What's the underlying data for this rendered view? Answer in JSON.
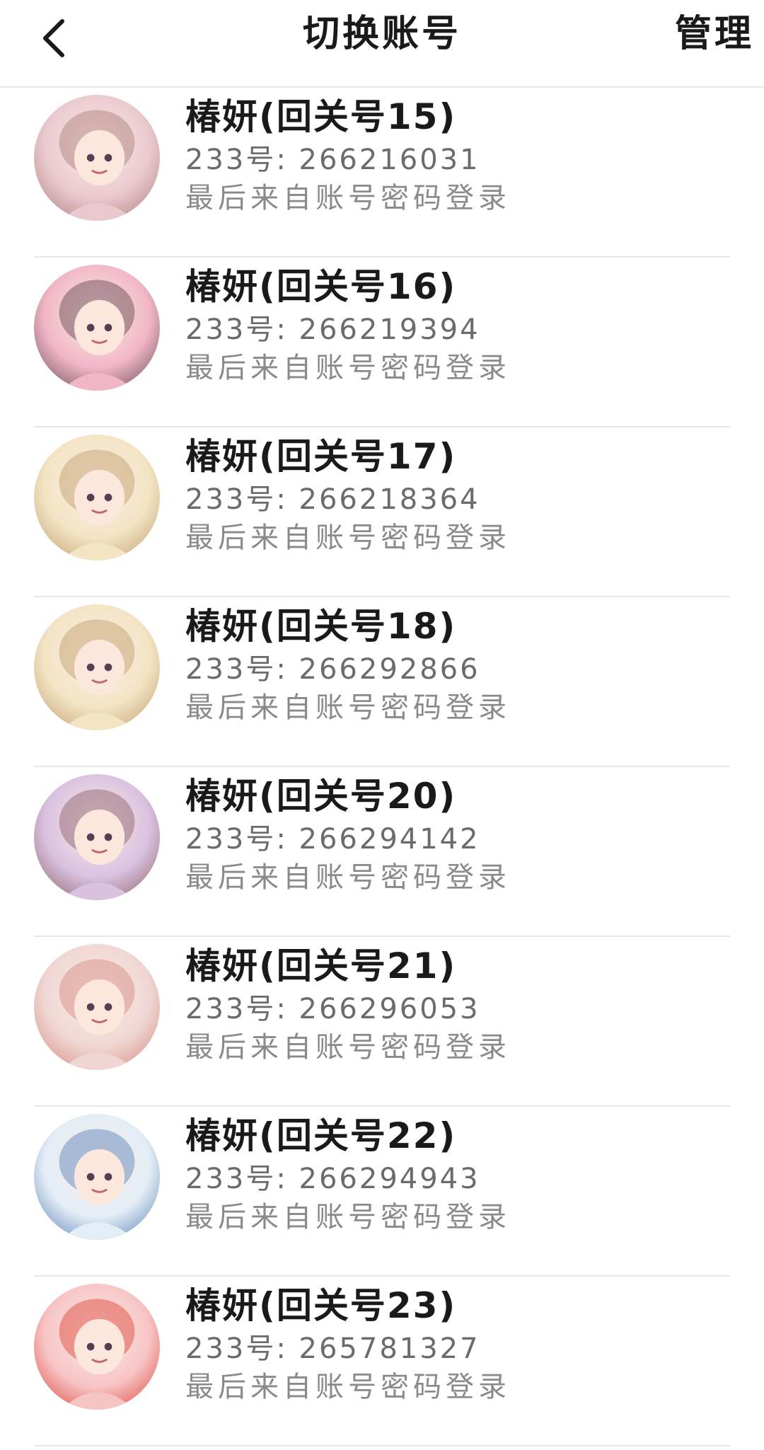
{
  "header": {
    "back_icon": "chevron-left-icon",
    "title": "切换账号",
    "manage_label": "管理"
  },
  "accounts": [
    {
      "name": "椿妍(回关号15)",
      "id_line": "233号: 266216031",
      "login_info": "最后来自账号密码登录",
      "avatar_colors": [
        "#e9c9cf",
        "#b78a86"
      ]
    },
    {
      "name": "椿妍(回关号16)",
      "id_line": "233号: 266219394",
      "login_info": "最后来自账号密码登录",
      "avatar_colors": [
        "#f1b6c6",
        "#7a5a62"
      ]
    },
    {
      "name": "椿妍(回关号17)",
      "id_line": "233号: 266218364",
      "login_info": "最后来自账号密码登录",
      "avatar_colors": [
        "#f3e4c4",
        "#c9a87a"
      ]
    },
    {
      "name": "椿妍(回关号18)",
      "id_line": "233号: 266292866",
      "login_info": "最后来自账号密码登录",
      "avatar_colors": [
        "#f3e4c4",
        "#c9a87a"
      ]
    },
    {
      "name": "椿妍(回关号20)",
      "id_line": "233号: 266294142",
      "login_info": "最后来自账号密码登录",
      "avatar_colors": [
        "#d9c1e0",
        "#9a6f7a"
      ]
    },
    {
      "name": "椿妍(回关号21)",
      "id_line": "233号: 266296053",
      "login_info": "最后来自账号密码登录",
      "avatar_colors": [
        "#f0d6d2",
        "#d9958c"
      ]
    },
    {
      "name": "椿妍(回关号22)",
      "id_line": "233号: 266294943",
      "login_info": "最后来自账号密码登录",
      "avatar_colors": [
        "#e3edf6",
        "#6f8fbf"
      ]
    },
    {
      "name": "椿妍(回关号23)",
      "id_line": "233号: 265781327",
      "login_info": "最后来自账号密码登录",
      "avatar_colors": [
        "#f7c4c4",
        "#e2574f"
      ]
    }
  ]
}
